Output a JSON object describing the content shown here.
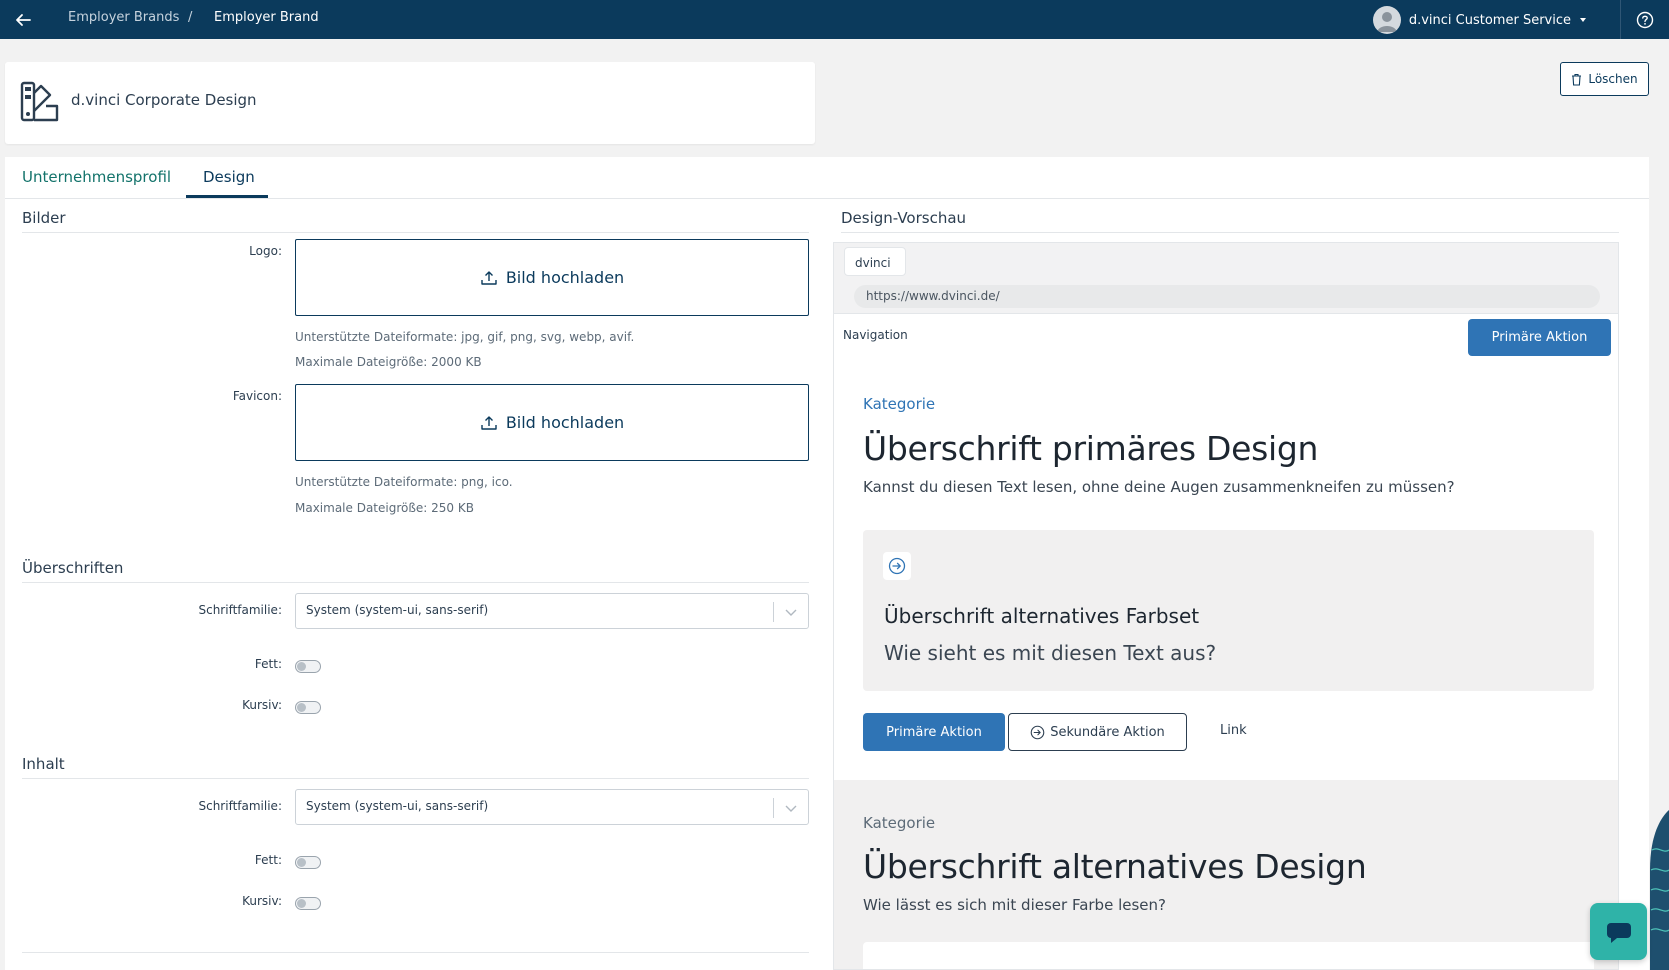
{
  "topbar": {
    "breadcrumb": [
      "Employer Brands",
      "/",
      "Employer Brand"
    ],
    "user_name": "d.vinci Customer Service",
    "colors": {
      "background": "#0b3a5c"
    }
  },
  "header": {
    "title": "d.vinci Corporate Design",
    "delete_label": "Löschen"
  },
  "tabs": [
    {
      "label": "Unternehmensprofil",
      "active": false
    },
    {
      "label": "Design",
      "active": true
    }
  ],
  "bilder": {
    "title": "Bilder",
    "logo": {
      "label": "Logo:",
      "upload_label": "Bild hochladen",
      "formats": "Unterstützte Dateiformate: jpg, gif, png, svg, webp, avif.",
      "max_size": "Maximale Dateigröße: 2000 KB"
    },
    "favicon": {
      "label": "Favicon:",
      "upload_label": "Bild hochladen",
      "formats": "Unterstützte Dateiformate: png, ico.",
      "max_size": "Maximale Dateigröße: 250 KB"
    }
  },
  "ueberschriften": {
    "title": "Überschriften",
    "font_label": "Schriftfamilie:",
    "font_value": "System (system-ui, sans-serif)",
    "bold_label": "Fett:",
    "bold": false,
    "italic_label": "Kursiv:",
    "italic": false
  },
  "inhalt": {
    "title": "Inhalt",
    "font_label": "Schriftfamilie:",
    "font_value": "System (system-ui, sans-serif)",
    "bold_label": "Fett:",
    "bold": false,
    "italic_label": "Kursiv:",
    "italic": false
  },
  "preview": {
    "title": "Design-Vorschau",
    "browser_tab": "dvinci",
    "url": "https://www.dvinci.de/",
    "nav_label": "Navigation",
    "nav_action": "Primäre Aktion",
    "primary": {
      "kategorie": "Kategorie",
      "heading": "Überschrift primäres Design",
      "text": "Kannst du diesen Text lesen, ohne deine Augen zusammenkneifen zu müssen?",
      "alt_heading": "Überschrift alternatives Farbset",
      "alt_text": "Wie sieht es mit diesen Text aus?",
      "primary_action": "Primäre Aktion",
      "secondary_action": "Sekundäre Aktion",
      "link": "Link"
    },
    "alternative": {
      "kategorie": "Kategorie",
      "heading": "Überschrift alternatives Design",
      "text": "Wie lässt es sich mit dieser Farbe lesen?"
    },
    "colors": {
      "primary": "#2f74b5",
      "accent_kategorie": "#2f74b5",
      "alt_background": "#f1f0f0"
    }
  },
  "icons": [
    "arrow-left-icon",
    "help-icon",
    "palette-icon",
    "trash-icon",
    "upload-icon",
    "chevron-down-icon",
    "arrow-circle-right-icon",
    "chat-icon"
  ],
  "colors": {
    "teal_tab": "#13736b",
    "chat": "#2fb3a8"
  }
}
